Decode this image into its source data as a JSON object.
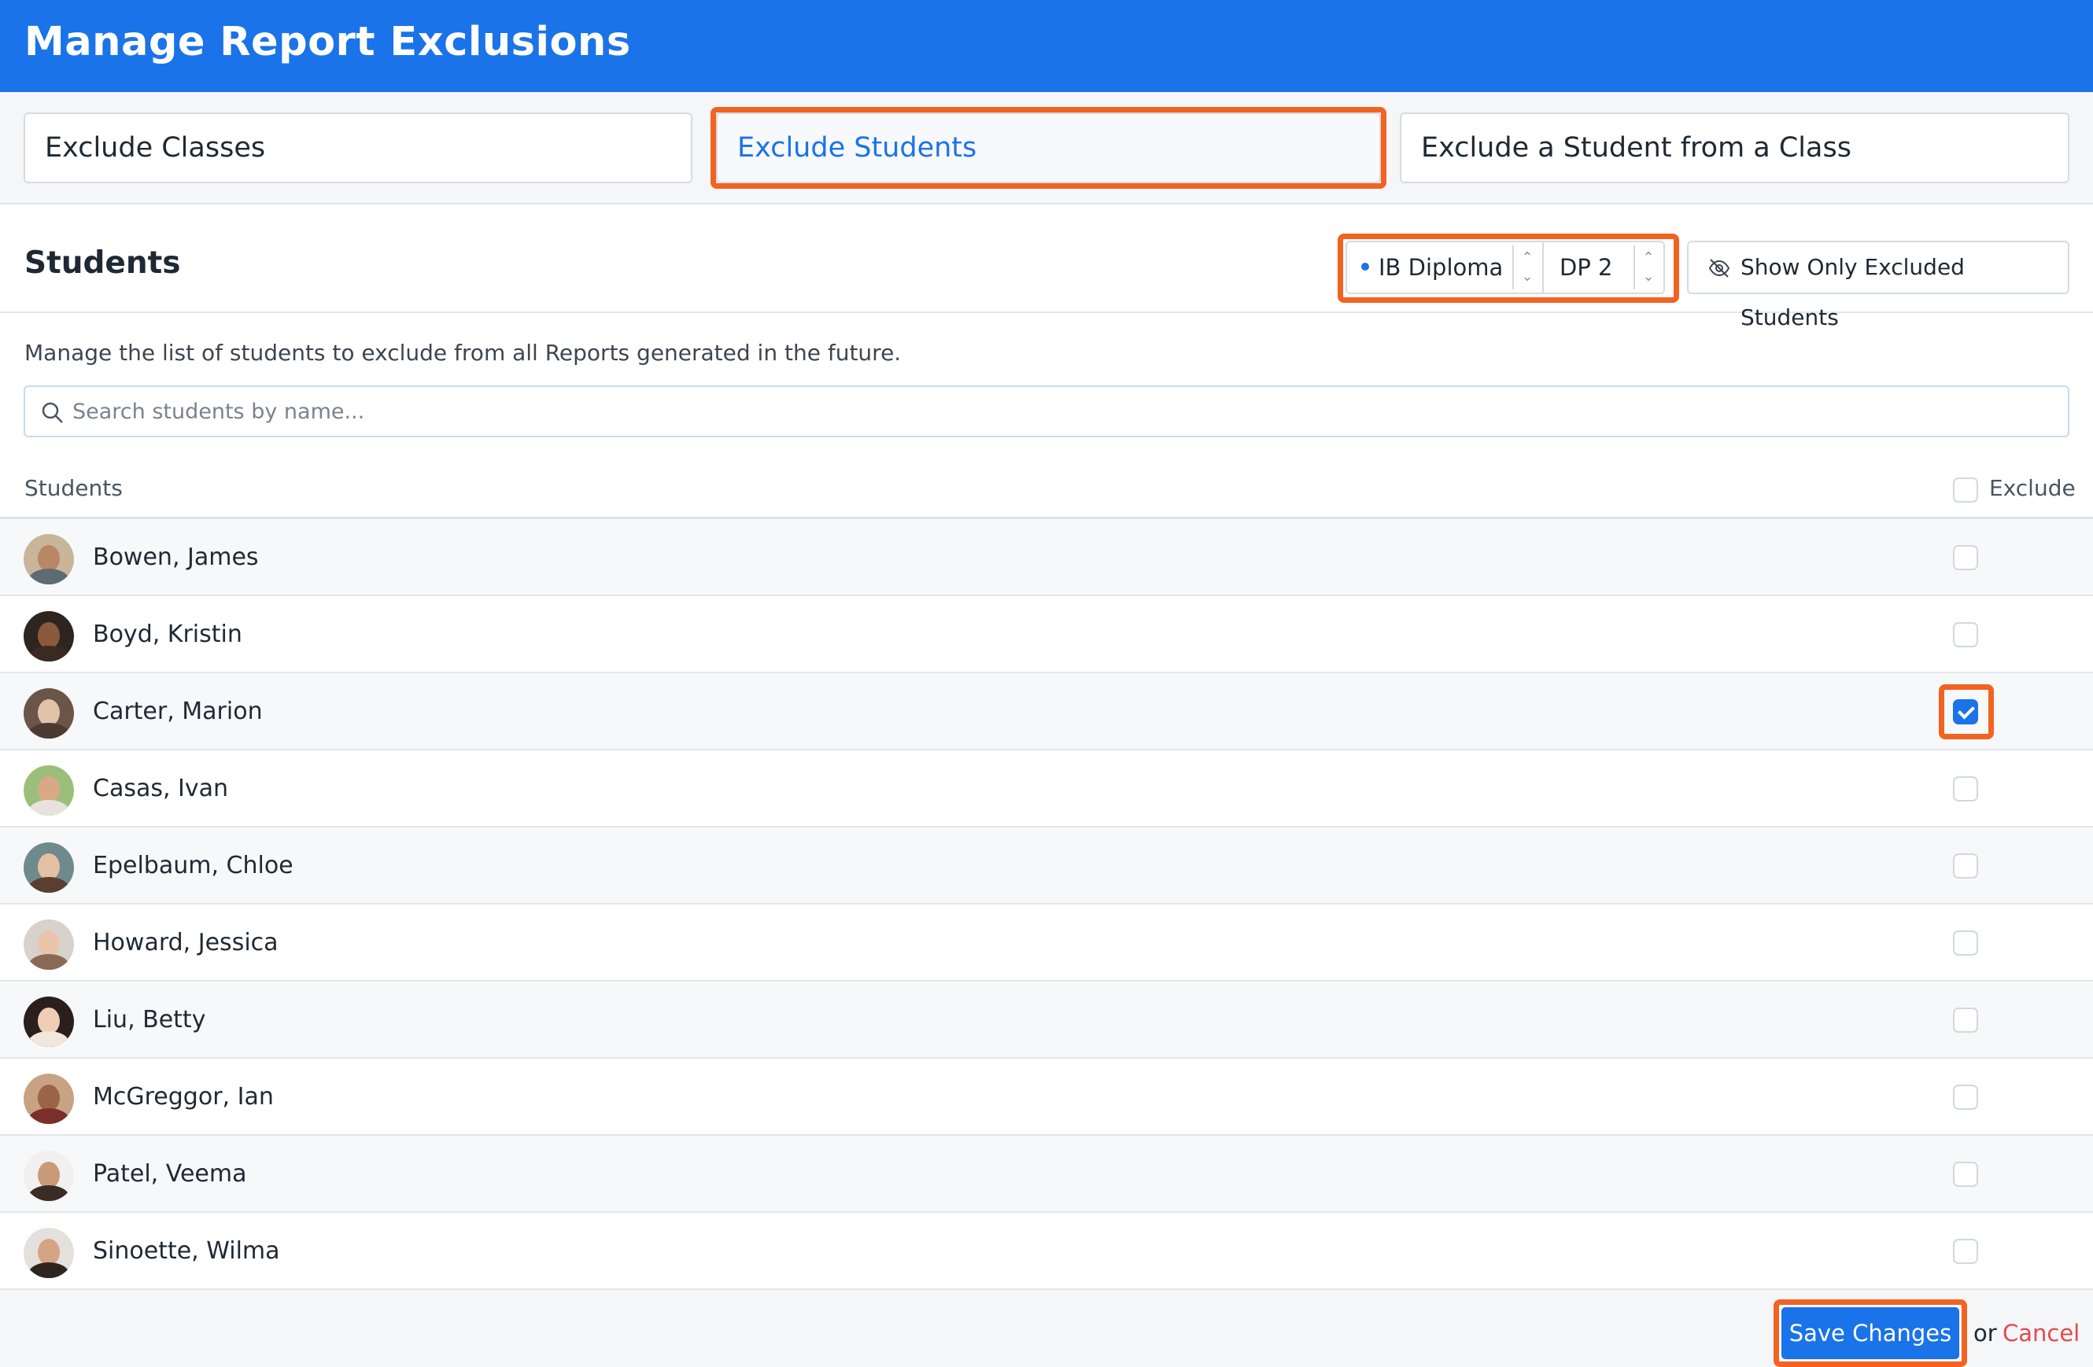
{
  "header": {
    "title": "Manage Report Exclusions"
  },
  "tabs": [
    {
      "label": "Exclude Classes",
      "active": false
    },
    {
      "label": "Exclude Students",
      "active": true
    },
    {
      "label": "Exclude a Student from a Class",
      "active": false
    }
  ],
  "section": {
    "title": "Students",
    "program_select": "IB Diploma",
    "grade_select": "DP 2",
    "show_excluded_label": "Show Only Excluded Students",
    "description": "Manage the list of students to exclude from all Reports generated in the future."
  },
  "search": {
    "placeholder": "Search students by name...",
    "value": ""
  },
  "table": {
    "col_students": "Students",
    "col_exclude": "Exclude",
    "rows": [
      {
        "name": "Bowen, James",
        "excluded": false
      },
      {
        "name": "Boyd, Kristin",
        "excluded": false
      },
      {
        "name": "Carter, Marion",
        "excluded": true
      },
      {
        "name": "Casas, Ivan",
        "excluded": false
      },
      {
        "name": "Epelbaum, Chloe",
        "excluded": false
      },
      {
        "name": "Howard, Jessica",
        "excluded": false
      },
      {
        "name": "Liu, Betty",
        "excluded": false
      },
      {
        "name": "McGreggor, Ian",
        "excluded": false
      },
      {
        "name": "Patel, Veema",
        "excluded": false
      },
      {
        "name": "Sinoette, Wilma",
        "excluded": false
      }
    ]
  },
  "footer": {
    "save_label": "Save Changes",
    "or_text": "or",
    "cancel_label": "Cancel"
  },
  "colors": {
    "brand": "#1a73e8",
    "highlight": "#f26322",
    "cancel": "#e5484d"
  }
}
